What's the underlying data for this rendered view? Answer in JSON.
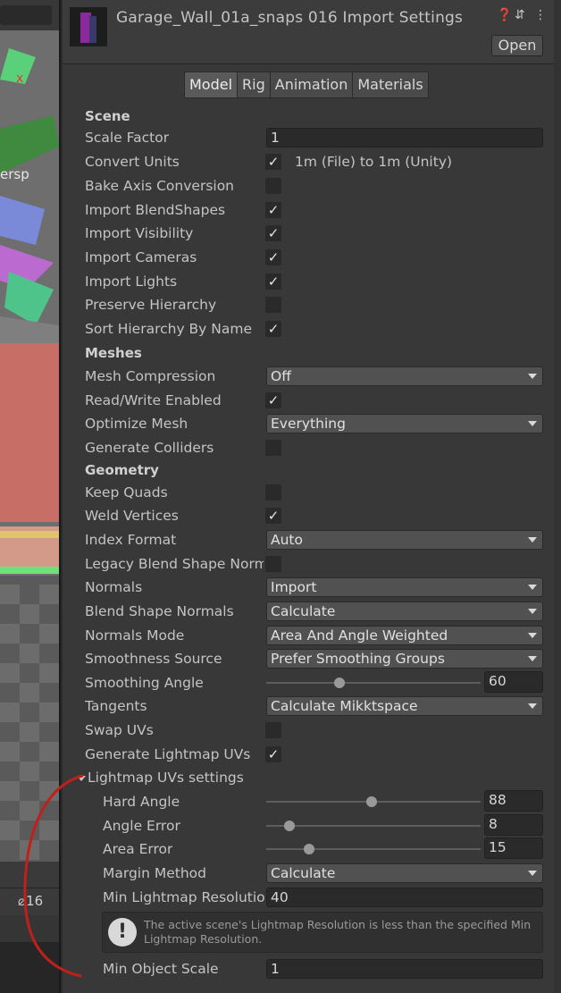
{
  "scene": {
    "persp_label": "ersp",
    "bottom_count": "16"
  },
  "header": {
    "title": "Garage_Wall_01a_snaps 016 Import Settings",
    "help_icon": "help-icon",
    "settings_icon": "sliders-icon",
    "more_icon": "kebab-icon",
    "open_label": "Open"
  },
  "tabs": [
    "Model",
    "Rig",
    "Animation",
    "Materials"
  ],
  "active_tab": "Model",
  "sections": {
    "scene": "Scene",
    "meshes": "Meshes",
    "geometry": "Geometry"
  },
  "fields": {
    "scale_factor": {
      "label": "Scale Factor",
      "value": "1"
    },
    "convert_units": {
      "label": "Convert Units",
      "checked": true,
      "note": "1m (File) to 1m (Unity)"
    },
    "bake_axis": {
      "label": "Bake Axis Conversion",
      "checked": false
    },
    "import_blendshapes": {
      "label": "Import BlendShapes",
      "checked": true
    },
    "import_visibility": {
      "label": "Import Visibility",
      "checked": true
    },
    "import_cameras": {
      "label": "Import Cameras",
      "checked": true
    },
    "import_lights": {
      "label": "Import Lights",
      "checked": true
    },
    "preserve_hierarchy": {
      "label": "Preserve Hierarchy",
      "checked": false
    },
    "sort_hierarchy": {
      "label": "Sort Hierarchy By Name",
      "checked": true
    },
    "mesh_compression": {
      "label": "Mesh Compression",
      "value": "Off"
    },
    "read_write": {
      "label": "Read/Write Enabled",
      "checked": true
    },
    "optimize_mesh": {
      "label": "Optimize Mesh",
      "value": "Everything"
    },
    "generate_colliders": {
      "label": "Generate Colliders",
      "checked": false
    },
    "keep_quads": {
      "label": "Keep Quads",
      "checked": false
    },
    "weld_vertices": {
      "label": "Weld Vertices",
      "checked": true
    },
    "index_format": {
      "label": "Index Format",
      "value": "Auto"
    },
    "legacy_blend": {
      "label": "Legacy Blend Shape Norm",
      "checked": false
    },
    "normals": {
      "label": "Normals",
      "value": "Import"
    },
    "blend_shape_normals": {
      "label": "Blend Shape Normals",
      "value": "Calculate"
    },
    "normals_mode": {
      "label": "Normals Mode",
      "value": "Area And Angle Weighted"
    },
    "smoothness_source": {
      "label": "Smoothness Source",
      "value": "Prefer Smoothing Groups"
    },
    "smoothing_angle": {
      "label": "Smoothing Angle",
      "value": "60",
      "fraction": 0.34
    },
    "tangents": {
      "label": "Tangents",
      "value": "Calculate Mikktspace"
    },
    "swap_uvs": {
      "label": "Swap UVs",
      "checked": false
    },
    "generate_lightmap_uvs": {
      "label": "Generate Lightmap UVs",
      "checked": true
    },
    "lightmap_settings": {
      "label": "Lightmap UVs settings"
    },
    "hard_angle": {
      "label": "Hard Angle",
      "value": "88",
      "fraction": 0.49
    },
    "angle_error": {
      "label": "Angle Error",
      "value": "8",
      "fraction": 0.11
    },
    "area_error": {
      "label": "Area Error",
      "value": "15",
      "fraction": 0.2
    },
    "margin_method": {
      "label": "Margin Method",
      "value": "Calculate"
    },
    "min_lightmap_res": {
      "label": "Min Lightmap Resolutior",
      "value": "40"
    },
    "min_object_scale": {
      "label": "Min Object Scale",
      "value": "1"
    }
  },
  "warning": {
    "icon": "warning-icon",
    "text": "The active scene's Lightmap Resolution is less than the specified Min Lightmap Resolution."
  },
  "colors": {
    "background": "#383838",
    "field": "#2a2a2a",
    "dropdown": "#515151",
    "annotation": "#c0201a"
  }
}
